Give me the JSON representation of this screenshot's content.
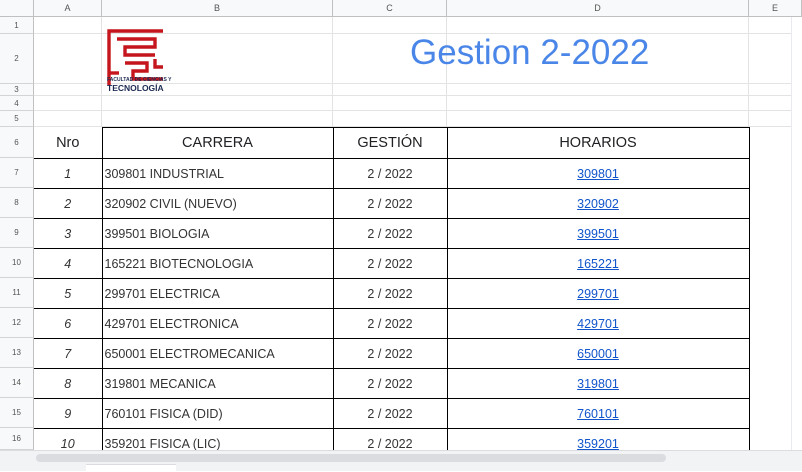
{
  "columns": [
    "A",
    "B",
    "C",
    "D",
    "E"
  ],
  "rows": [
    "1",
    "2",
    "3",
    "4",
    "5",
    "6",
    "7",
    "8",
    "9",
    "10",
    "11",
    "12",
    "13",
    "14",
    "15",
    "16"
  ],
  "title": "Gestion 2-2022",
  "logo": {
    "line1": "FACULTAD DE CIENCIAS Y",
    "line2": "TECNOLOGÍA"
  },
  "table": {
    "headers": {
      "nro": "Nro",
      "carrera": "CARRERA",
      "gestion": "GESTIÓN",
      "horarios": "HORARIOS"
    },
    "rows": [
      {
        "nro": "1",
        "carrera": "309801 INDUSTRIAL",
        "gestion": "2 / 2022",
        "horario": "309801"
      },
      {
        "nro": "2",
        "carrera": "320902 CIVIL (NUEVO)",
        "gestion": "2 / 2022",
        "horario": "320902"
      },
      {
        "nro": "3",
        "carrera": "399501 BIOLOGIA",
        "gestion": "2 / 2022",
        "horario": "399501"
      },
      {
        "nro": "4",
        "carrera": "165221 BIOTECNOLOGIA",
        "gestion": "2 / 2022",
        "horario": "165221"
      },
      {
        "nro": "5",
        "carrera": "299701 ELECTRICA",
        "gestion": "2 / 2022",
        "horario": "299701"
      },
      {
        "nro": "6",
        "carrera": "429701 ELECTRONICA",
        "gestion": "2 / 2022",
        "horario": "429701"
      },
      {
        "nro": "7",
        "carrera": "650001 ELECTROMECANICA",
        "gestion": "2 / 2022",
        "horario": "650001"
      },
      {
        "nro": "8",
        "carrera": "319801 MECANICA",
        "gestion": "2 / 2022",
        "horario": "319801"
      },
      {
        "nro": "9",
        "carrera": "760101 FISICA (DID)",
        "gestion": "2 / 2022",
        "horario": "760101"
      },
      {
        "nro": "10",
        "carrera": "359201 FISICA (LIC)",
        "gestion": "2 / 2022",
        "horario": "359201"
      }
    ]
  },
  "colors": {
    "title": "#4a86e8",
    "link": "#1155cc",
    "logo_red": "#c4161c",
    "logo_navy": "#1c2a52"
  }
}
